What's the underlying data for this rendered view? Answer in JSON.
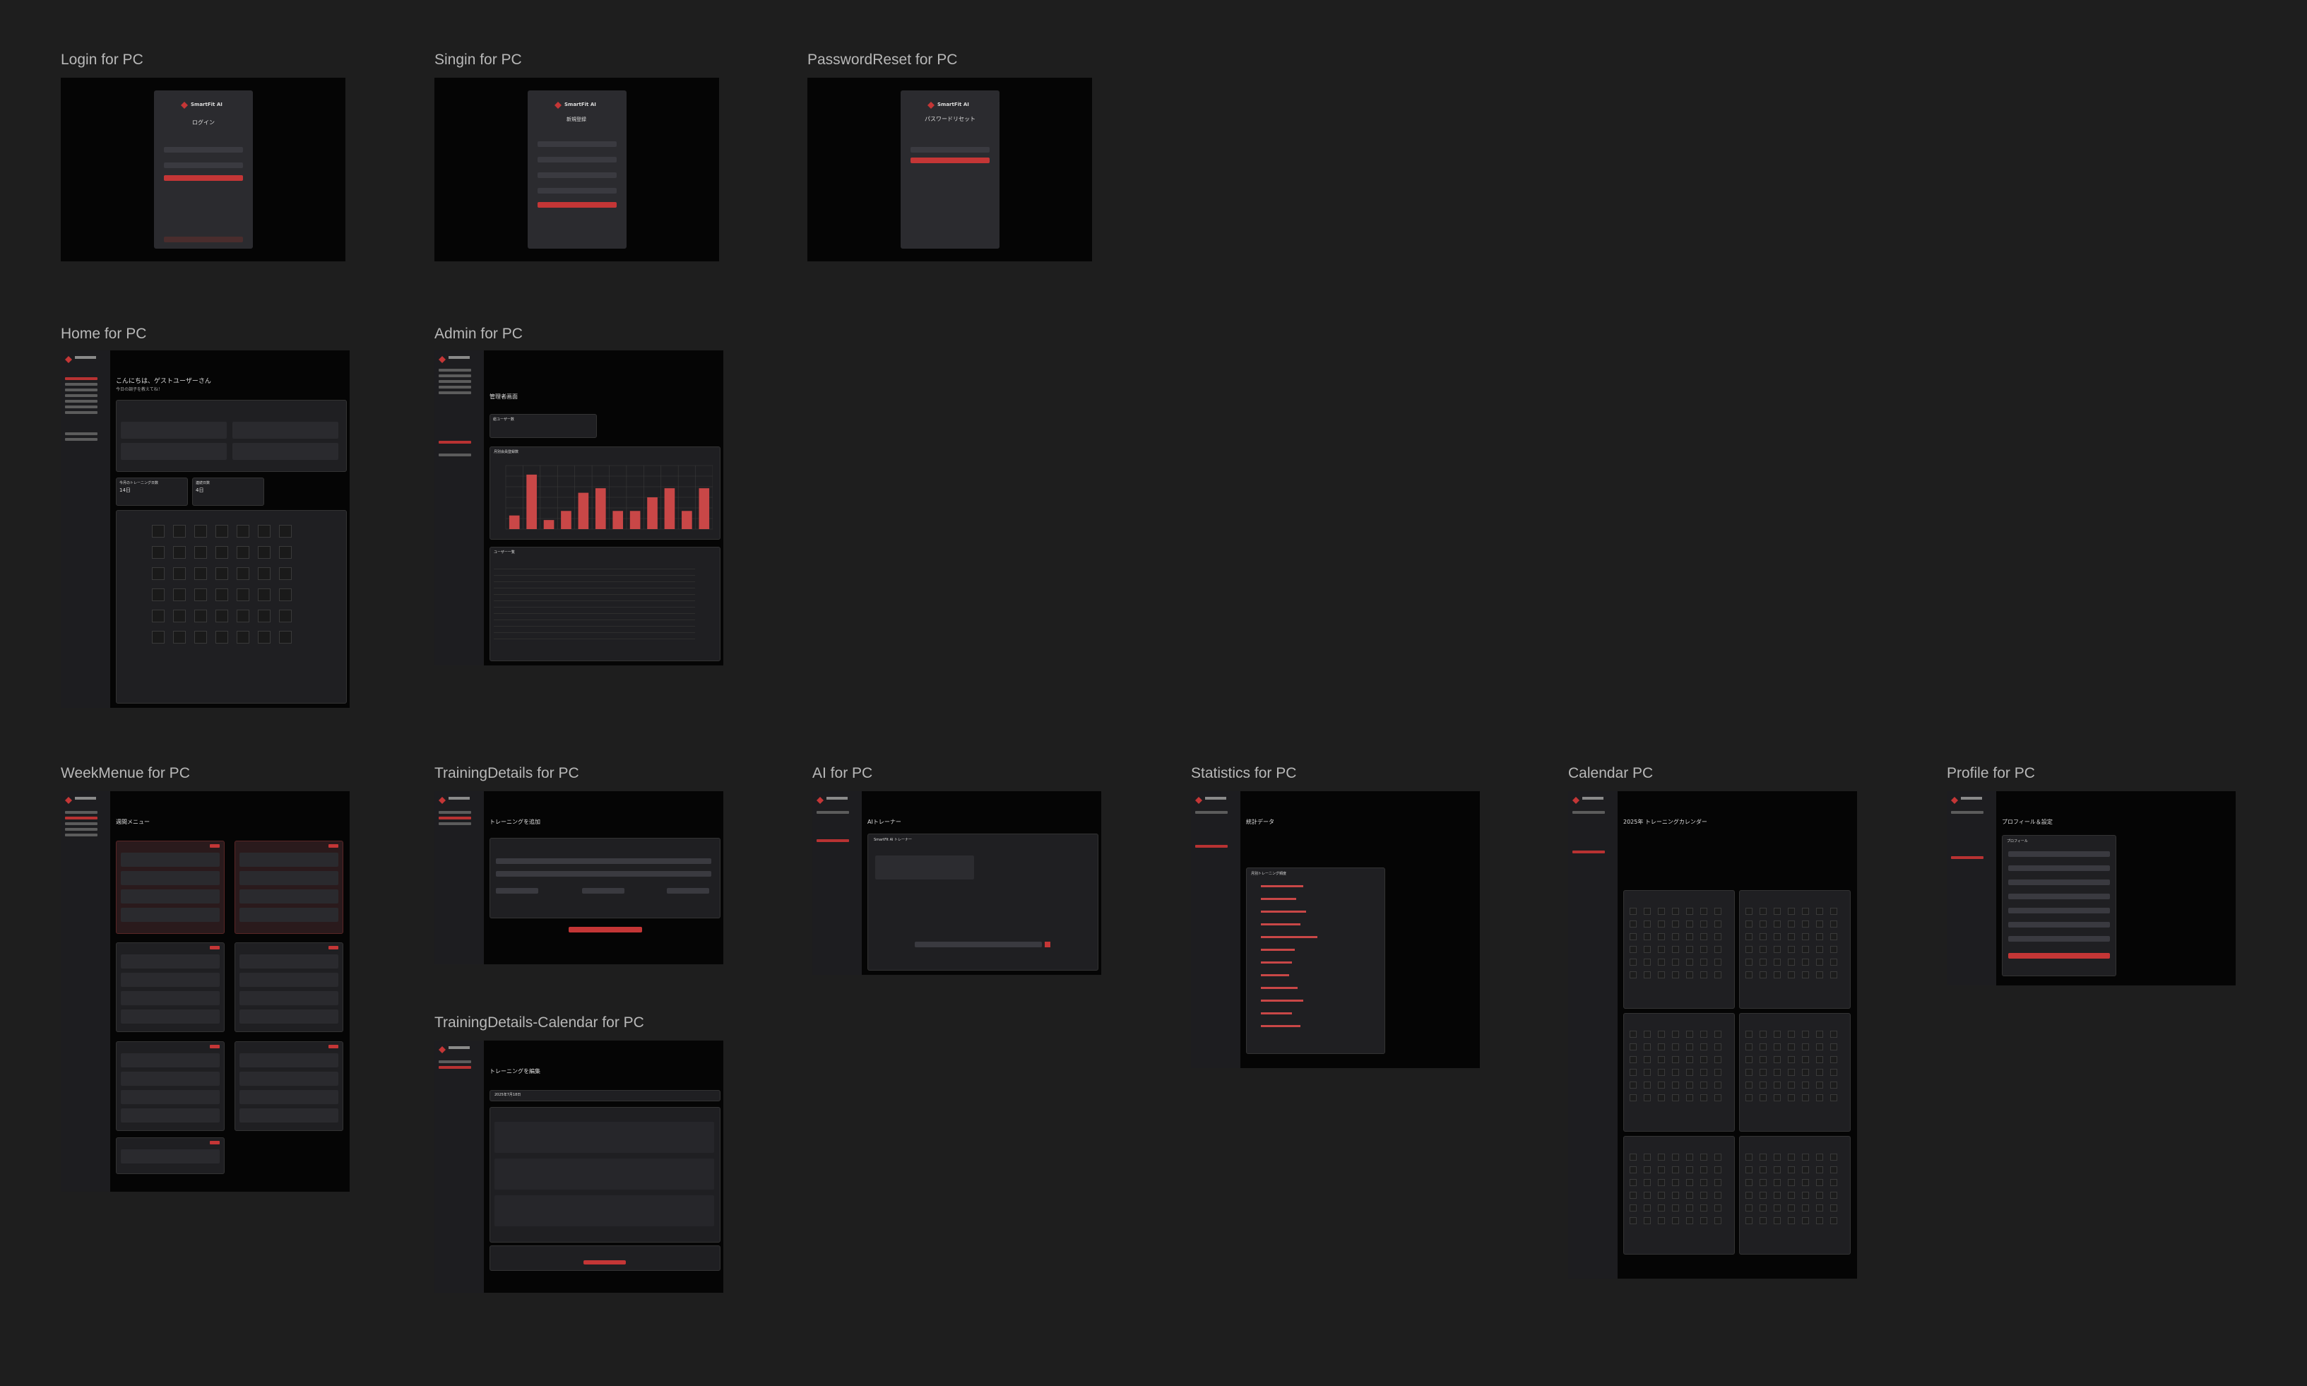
{
  "canvas": {
    "background": "#1e1e1e"
  },
  "frames": {
    "login": {
      "label": "Login for PC"
    },
    "signin": {
      "label": "Singin for PC"
    },
    "password_reset": {
      "label": "PasswordReset for PC"
    },
    "home": {
      "label": "Home for PC"
    },
    "admin": {
      "label": "Admin for PC"
    },
    "week_menu": {
      "label": "WeekMenue for PC"
    },
    "training_details": {
      "label": "TrainingDetails for PC"
    },
    "training_details_calendar": {
      "label": "TrainingDetails-Calendar for PC"
    },
    "ai": {
      "label": "AI for PC"
    },
    "statistics": {
      "label": "Statistics for PC"
    },
    "calendar": {
      "label": "Calendar PC"
    },
    "profile": {
      "label": "Profile for PC"
    }
  },
  "login": {
    "brand": "SmartFit AI",
    "title": "ログイン"
  },
  "signin": {
    "brand": "SmartFit AI",
    "title": "新規登録"
  },
  "password_reset": {
    "brand": "SmartFit AI",
    "title": "パスワードリセット"
  },
  "home": {
    "greeting": "こんにちは、ゲストユーザーさん",
    "subgreeting": "今日の調子を教えてね！",
    "stats": [
      {
        "label": "今月のトレーニング日数",
        "value": "14日"
      },
      {
        "label": "連続日数",
        "value": "4日"
      }
    ]
  },
  "admin": {
    "title": "管理者画面",
    "users_count_label": "総ユーザー数",
    "chart_title": "月別会員登録数",
    "table_title": "ユーザー一覧"
  },
  "week_menu": {
    "title": "週間メニュー"
  },
  "training_details": {
    "title": "トレーニングを追加"
  },
  "training_details_calendar": {
    "title": "トレーニングを編集",
    "date": "2025年7月18日"
  },
  "ai": {
    "title": "AIトレーナー",
    "header": "SmartFit AI トレーナー"
  },
  "statistics": {
    "title": "統計データ",
    "section": "月別トレーニング頻度"
  },
  "calendar": {
    "title": "2025年 トレーニングカレンダー"
  },
  "profile": {
    "title": "プロフィール＆設定",
    "section": "プロフィール"
  },
  "chart_data": {
    "type": "bar",
    "categories": [
      "1",
      "2",
      "3",
      "4",
      "5",
      "6",
      "7",
      "8",
      "9",
      "10",
      "11",
      "12"
    ],
    "values": [
      3,
      12,
      2,
      4,
      8,
      9,
      4,
      4,
      7,
      9,
      4,
      9
    ],
    "ylim": [
      0,
      14
    ]
  }
}
